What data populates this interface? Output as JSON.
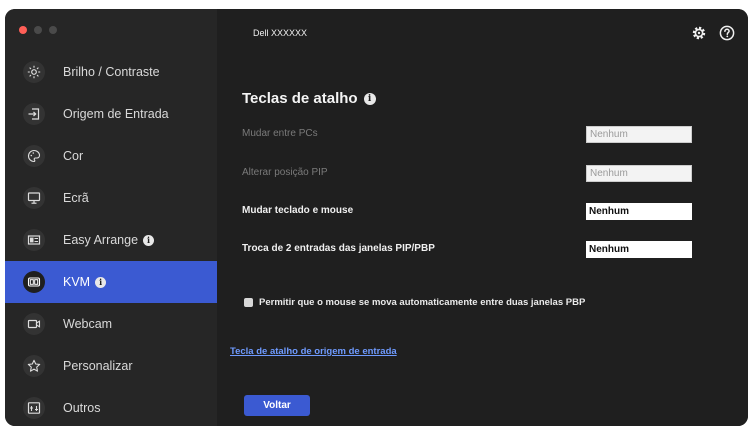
{
  "window": {
    "title": "Dell XXXXXX",
    "traffic_lights": [
      "#ff5f57",
      "#4a4a4a",
      "#4a4a4a"
    ],
    "accent": "#3b5ad2"
  },
  "sidebar": {
    "items": [
      {
        "label": "Brilho / Contraste",
        "icon": "brightness-icon",
        "active": false,
        "info": false
      },
      {
        "label": "Origem de Entrada",
        "icon": "input-source-icon",
        "active": false,
        "info": false
      },
      {
        "label": "Cor",
        "icon": "color-palette-icon",
        "active": false,
        "info": false
      },
      {
        "label": "Ecrã",
        "icon": "monitor-icon",
        "active": false,
        "info": false
      },
      {
        "label": "Easy Arrange",
        "icon": "easy-arrange-icon",
        "active": false,
        "info": true
      },
      {
        "label": "KVM",
        "icon": "kvm-icon",
        "active": true,
        "info": true
      },
      {
        "label": "Webcam",
        "icon": "webcam-icon",
        "active": false,
        "info": false
      },
      {
        "label": "Personalizar",
        "icon": "star-icon",
        "active": false,
        "info": false
      },
      {
        "label": "Outros",
        "icon": "others-icon",
        "active": false,
        "info": false
      }
    ]
  },
  "main": {
    "heading": "Teclas de atalho",
    "rows": [
      {
        "label": "Mudar entre PCs",
        "value": "Nenhum",
        "enabled": false
      },
      {
        "label": "Alterar posição PIP",
        "value": "Nenhum",
        "enabled": false
      },
      {
        "label": "Mudar teclado e mouse",
        "value": "Nenhum",
        "enabled": true
      },
      {
        "label": "Troca de 2 entradas das janelas PIP/PBP",
        "value": "Nenhum",
        "enabled": true
      }
    ],
    "checkbox_label": "Permitir que o mouse se mova automaticamente entre duas janelas PBP",
    "checkbox_checked": false,
    "link_text": "Tecla de atalho de origem de entrada",
    "back_label": "Voltar"
  }
}
